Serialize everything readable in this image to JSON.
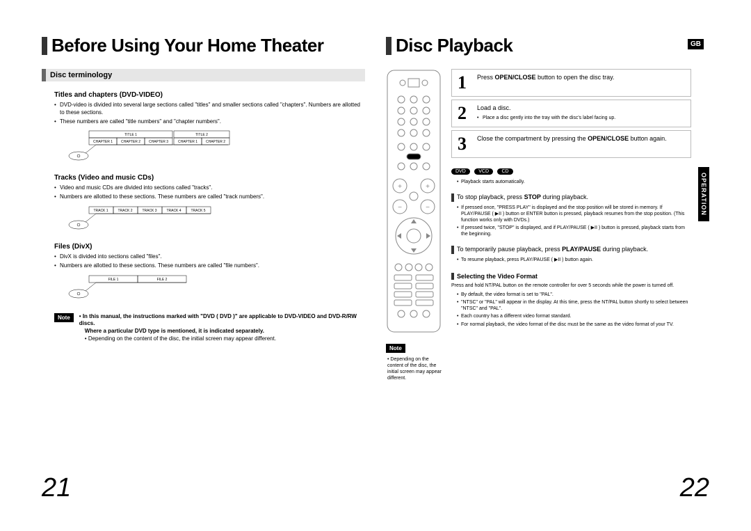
{
  "left": {
    "title": "Before Using Your Home Theater",
    "section": "Disc terminology",
    "titles_head": "Titles and chapters (DVD-VIDEO)",
    "titles_bullets": [
      "DVD-video is divided into several large sections called \"titles\" and smaller sections called \"chapters\". Numbers are allotted to these sections.",
      "These numbers are called \"title numbers\" and \"chapter numbers\"."
    ],
    "diagram1": {
      "title1": "TITLE 1",
      "title2": "TITLE 2",
      "chapters": [
        "CHAPTER 1",
        "CHAPTER 2",
        "CHAPTER 3",
        "CHAPTER 1",
        "CHAPTER 2"
      ]
    },
    "tracks_head": "Tracks (Video and music CDs)",
    "tracks_bullets": [
      "Video and music CDs are divided into sections called \"tracks\".",
      "Numbers are allotted to these sections. These numbers are called \"track numbers\"."
    ],
    "diagram2": {
      "tracks": [
        "TRACK 1",
        "TRACK 2",
        "TRACK 3",
        "TRACK 4",
        "TRACK 5"
      ]
    },
    "files_head": "Files (DivX)",
    "files_bullets": [
      "DivX is divided into sections called \"files\".",
      "Numbers are allotted to these sections. These numbers are called \"file numbers\"."
    ],
    "diagram3": {
      "files": [
        "FILE 1",
        "FILE 2"
      ]
    },
    "note1": "In this manual, the instructions marked with \"DVD (  DVD  )\" are applicable to DVD-VIDEO and DVD-R/RW discs.",
    "note2": "Where a particular DVD type is mentioned, it is indicated separately.",
    "note3": "Depending on the content of the disc, the initial screen may appear different.",
    "page": "21"
  },
  "right": {
    "title": "Disc Playback",
    "gb": "GB",
    "side": "OPERATION",
    "remote_note1": "Depending on the content of the disc, the initial screen may appear different.",
    "steps": [
      {
        "n": "1",
        "text_a": "Press ",
        "text_b": "OPEN/CLOSE",
        "text_c": " button to open the disc tray."
      },
      {
        "n": "2",
        "text": "Load a disc.",
        "sub": "Place a disc gently into the tray with the disc's label facing up."
      },
      {
        "n": "3",
        "text_a": "Close the compartment by pressing the ",
        "text_b": "OPEN/CLOSE",
        "text_c": " button again."
      }
    ],
    "pills": [
      "DVD",
      "VCD",
      "CD"
    ],
    "auto": "Playback starts automatically.",
    "stop_head": "To stop playback, press STOP during playback.",
    "stop_bullets": [
      "If pressed once, \"PRESS PLAY\" is displayed and the stop position will be stored in memory. If PLAY/PAUSE ( ▶II ) button or ENTER button is pressed, playback resumes from the stop position. (This function works only with DVDs.)",
      "If pressed twice, \"STOP\" is displayed, and if PLAY/PAUSE ( ▶II ) button is pressed, playback starts from the beginning."
    ],
    "pause_head": "To temporarily pause playback, press PLAY/PAUSE during playback.",
    "pause_bullet": "To resume playback, press PLAY/PAUSE ( ▶II ) button again.",
    "video_head": "Selecting the Video Format",
    "video_intro": "Press and hold NT/PAL button on the remote controller for over 5 seconds while the power is turned off.",
    "video_bullets": [
      "By default, the video format is set to \"PAL\".",
      "\"NTSC\" or \"PAL\" will appear in the display. At this time, press the NT/PAL button shortly to select between \"NTSC\" and \"PAL\".",
      "Each country has a different video format standard.",
      "For normal playback, the video format of the disc must be the same as the video format of your TV."
    ],
    "page": "22"
  }
}
